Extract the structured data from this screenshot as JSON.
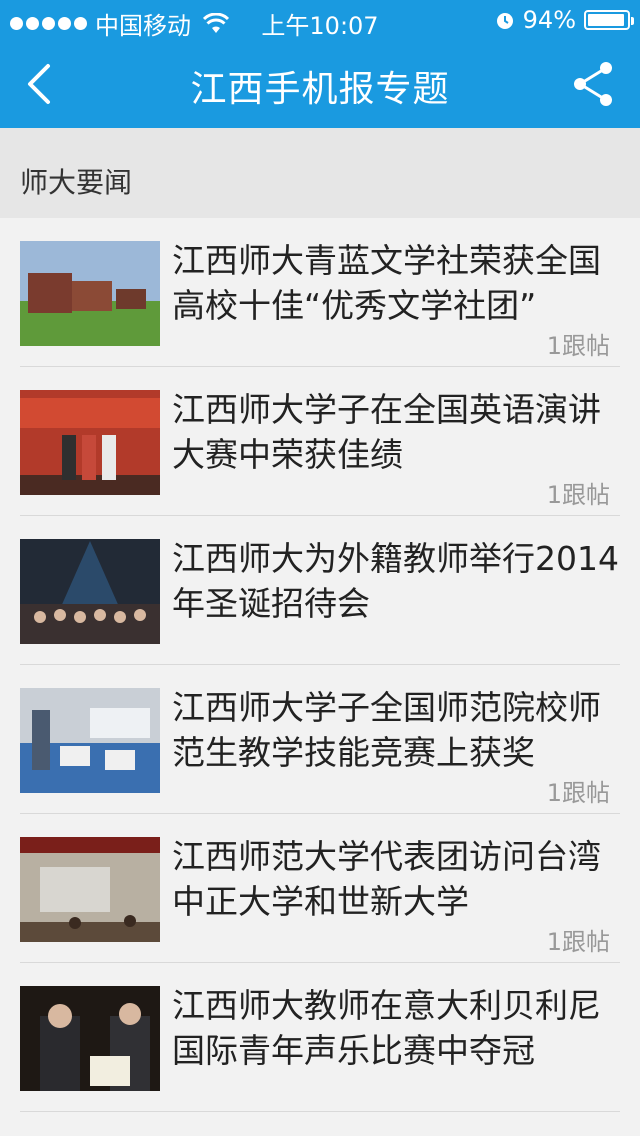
{
  "status": {
    "carrier": "中国移动",
    "time": "上午10:07",
    "battery": "94%",
    "battery_level": 0.94
  },
  "nav": {
    "title": "江西手机报专题",
    "back_icon": "chevron-left-icon",
    "share_icon": "share-icon"
  },
  "section": {
    "title": "师大要闻"
  },
  "articles": [
    {
      "title": "江西师大青蓝文学社荣获全国高校十佳“优秀文学社团”",
      "replies": "1跟帖"
    },
    {
      "title": "江西师大学子在全国英语演讲大赛中荣获佳绩",
      "replies": "1跟帖"
    },
    {
      "title": "江西师大为外籍教师举行2014年圣诞招待会",
      "replies": ""
    },
    {
      "title": "江西师大学子全国师范院校师范生教学技能竞赛上获奖",
      "replies": "1跟帖"
    },
    {
      "title": "江西师范大学代表团访问台湾中正大学和世新大学",
      "replies": "1跟帖"
    },
    {
      "title": "江西师大教师在意大利贝利尼国际青年声乐比赛中夺冠",
      "replies": ""
    }
  ],
  "colors": {
    "primary": "#1a9ae0",
    "background": "#f2f2f2",
    "section_bg": "#e6e6e6"
  }
}
